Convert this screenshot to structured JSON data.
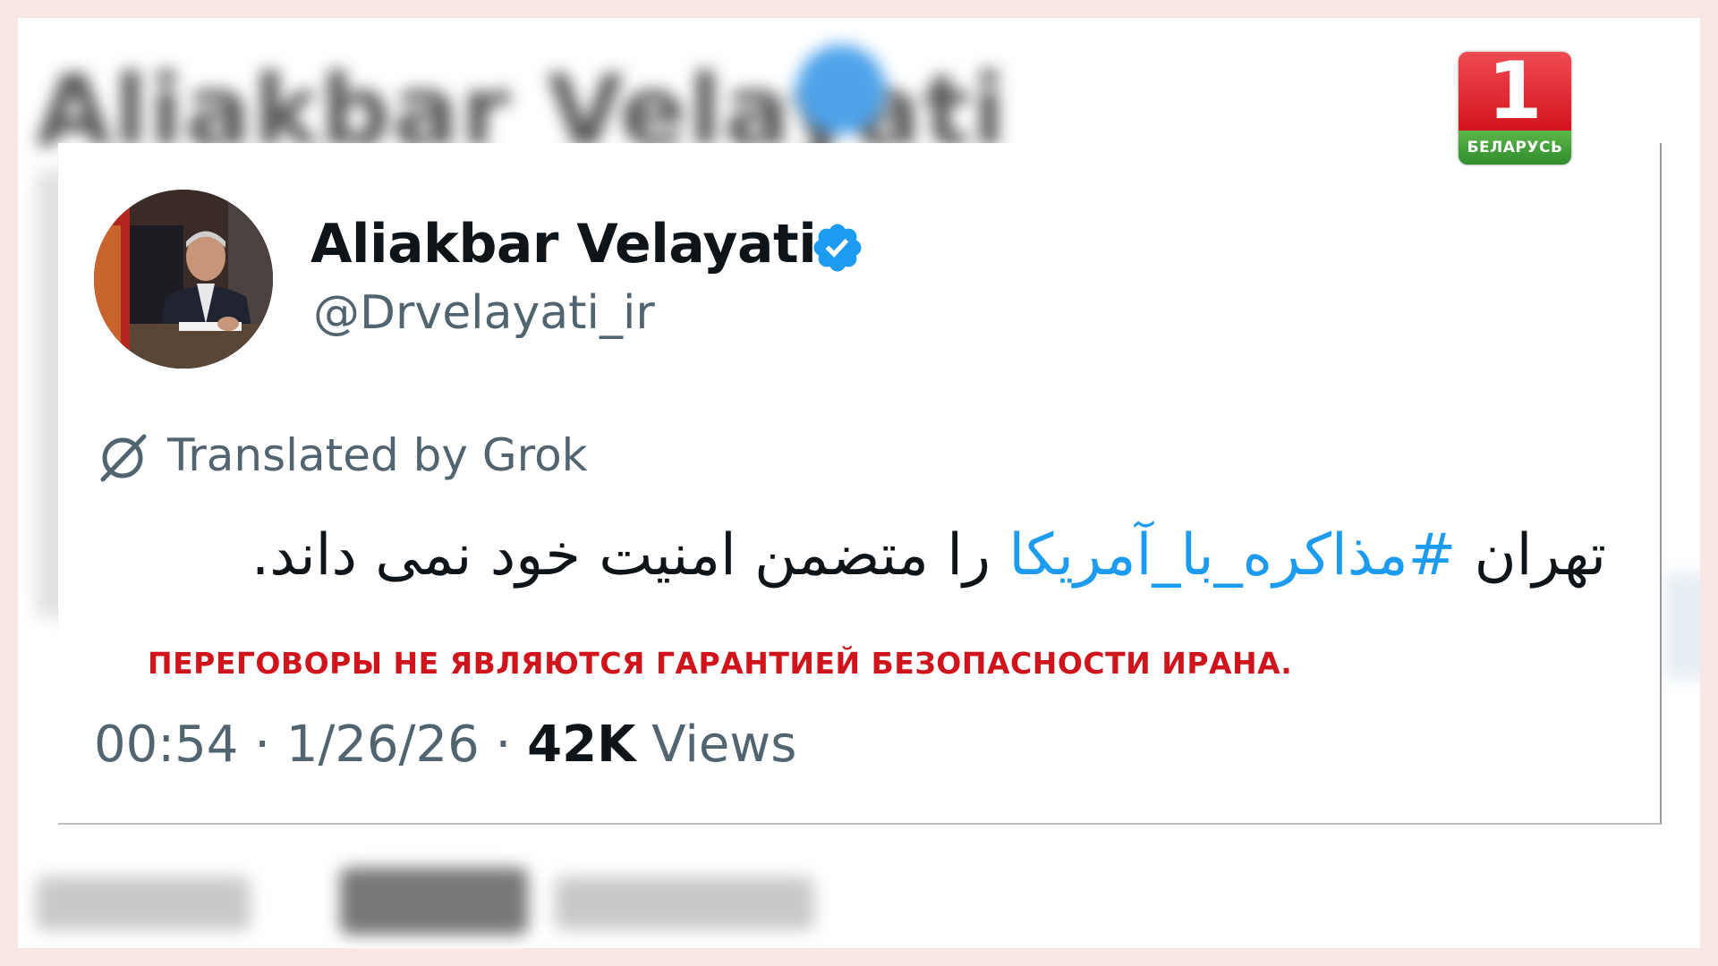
{
  "channel_logo": {
    "number": "1",
    "name": "БЕЛАРУСЬ"
  },
  "background": {
    "blurred_name": "Aliakbar Velayati"
  },
  "tweet": {
    "author_name": "Aliakbar Velayati",
    "handle": "@Drvelayati_ir",
    "translation_label": "Translated by Grok",
    "text_before": "تهران ",
    "hashtag": "#مذاکره_با_آمریکا",
    "text_after": " را متضمن امنیت خود نمی داند.",
    "caption": "ПЕРЕГОВОРЫ НЕ ЯВЛЯЮТСЯ ГАРАНТИЕЙ БЕЗОПАСНОСТИ ИРАНА.",
    "time": "00:54",
    "date": "1/26/26",
    "views_count": "42K",
    "views_label": "Views",
    "separator": "·"
  },
  "colors": {
    "hashtag": "#1d9bf0",
    "verified": "#1d9bf0",
    "caption": "#d0141c",
    "secondary_text": "#536471",
    "primary_text": "#0f1419"
  },
  "icons": {
    "verified": "verified-badge-icon",
    "grok": "grok-icon"
  }
}
